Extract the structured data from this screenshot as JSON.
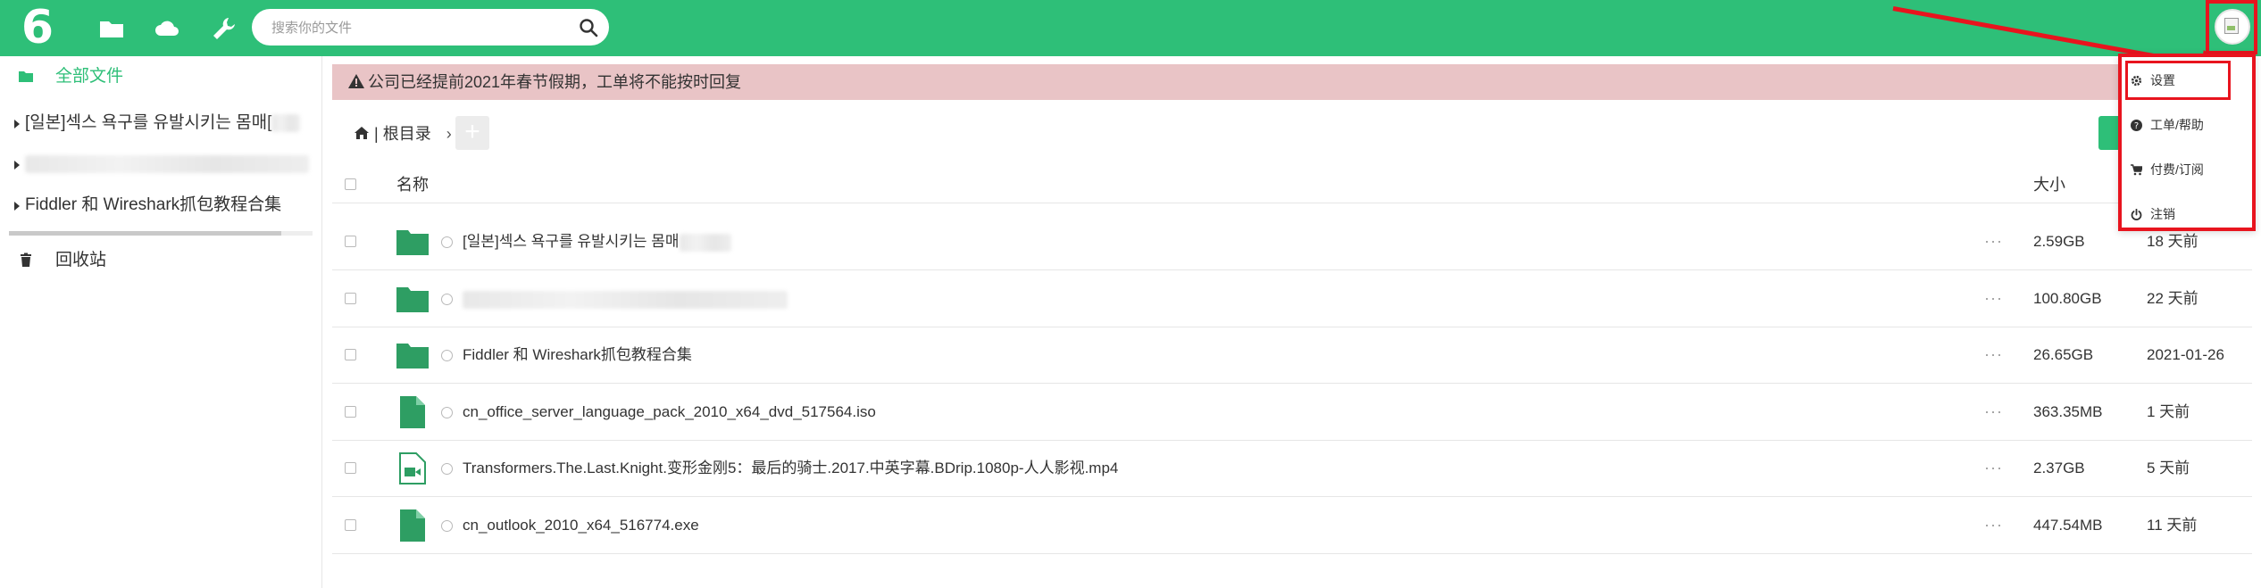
{
  "colors": {
    "brand": "#2ebf78",
    "alert_bg": "#e9c4c6",
    "highlight": "#e8141e"
  },
  "topbar": {
    "logo": "6",
    "nav_icons": [
      "folder-icon",
      "cloud-icon",
      "wrench-icon"
    ],
    "search": {
      "placeholder": "搜索你的文件"
    }
  },
  "sidebar": {
    "all_files": "全部文件",
    "tree": [
      {
        "label": "[일본]섹스 욕구를 유발시키는 몸매["
      },
      {
        "label": ""
      },
      {
        "label": "Fiddler 和 Wireshark抓包教程合集"
      }
    ],
    "trash": "回收站"
  },
  "notice": {
    "text": "公司已经提前2021年春节假期，工单将不能按时回复"
  },
  "breadcrumb": {
    "root": "| 根目录",
    "separator": "›",
    "add_label": "+"
  },
  "table": {
    "headers": {
      "name": "名称",
      "size": "大小"
    },
    "rows": [
      {
        "icon": "folder-icon",
        "name": "[일본]섹스 욕구를 유발시키는 몸매",
        "more": "···",
        "size": "2.59GB",
        "date": "18 天前"
      },
      {
        "icon": "folder-icon",
        "name": "",
        "more": "···",
        "size": "100.80GB",
        "date": "22 天前"
      },
      {
        "icon": "folder-icon",
        "name": "Fiddler 和 Wireshark抓包教程合集",
        "more": "···",
        "size": "26.65GB",
        "date": "2021-01-26"
      },
      {
        "icon": "file-icon",
        "name": "cn_office_server_language_pack_2010_x64_dvd_517564.iso",
        "more": "···",
        "size": "363.35MB",
        "date": "1 天前"
      },
      {
        "icon": "video-file-icon",
        "name": "Transformers.The.Last.Knight.变形金刚5：最后的骑士.2017.中英字幕.BDrip.1080p-人人影视.mp4",
        "more": "···",
        "size": "2.37GB",
        "date": "5 天前"
      },
      {
        "icon": "file-icon",
        "name": "cn_outlook_2010_x64_516774.exe",
        "more": "···",
        "size": "447.54MB",
        "date": "11 天前"
      }
    ]
  },
  "user_menu": {
    "items": [
      {
        "icon": "gear-icon",
        "label": "设置"
      },
      {
        "icon": "question-icon",
        "label": "工单/帮助"
      },
      {
        "icon": "cart-icon",
        "label": "付费/订阅"
      },
      {
        "icon": "power-icon",
        "label": "注销"
      }
    ]
  }
}
